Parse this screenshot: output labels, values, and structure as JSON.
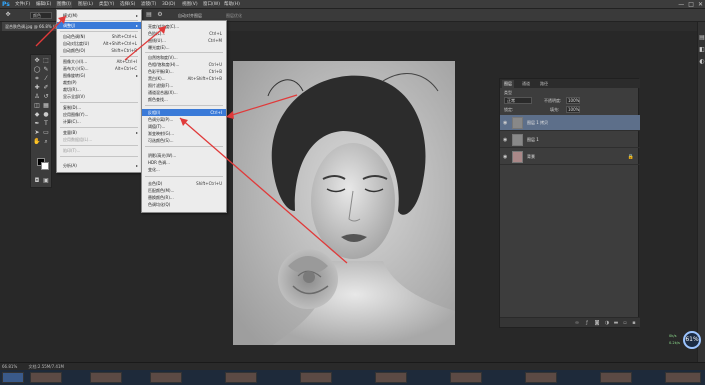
{
  "app": {
    "logo": "Ps",
    "menus": [
      "文件(F)",
      "编辑(E)",
      "图像(I)",
      "图层(L)",
      "类型(Y)",
      "选择(S)",
      "滤镜(T)",
      "3D(D)",
      "视图(V)",
      "窗口(W)",
      "帮助(H)"
    ],
    "window_controls": [
      "—",
      "□",
      "✕"
    ]
  },
  "options_bar": {
    "mode_value": "颜色",
    "auto_align_label": "自动对齐图层",
    "checkbox_label": "图层优化"
  },
  "document": {
    "tab_label": "混合肤色调.jpg @ 66.8% (图层 1 拷贝, RGB/8)"
  },
  "image_menu": {
    "items": [
      {
        "label": "模式(M)",
        "shortcut": "",
        "submenu": true
      },
      {
        "label": "调整(J)",
        "shortcut": "",
        "submenu": true,
        "highlighted": true
      },
      {
        "label": "自动色调(N)",
        "shortcut": "Shift+Ctrl+L"
      },
      {
        "label": "自动对比度(U)",
        "shortcut": "Alt+Shift+Ctrl+L"
      },
      {
        "label": "自动颜色(O)",
        "shortcut": "Shift+Ctrl+B"
      },
      {
        "label": "图像大小(I)...",
        "shortcut": "Alt+Ctrl+I"
      },
      {
        "label": "画布大小(S)...",
        "shortcut": "Alt+Ctrl+C"
      },
      {
        "label": "图像旋转(G)",
        "shortcut": "",
        "submenu": true
      },
      {
        "label": "裁剪(P)",
        "shortcut": ""
      },
      {
        "label": "裁切(R)...",
        "shortcut": ""
      },
      {
        "label": "显示全部(V)",
        "shortcut": ""
      },
      {
        "label": "复制(D)...",
        "shortcut": ""
      },
      {
        "label": "应用图像(Y)...",
        "shortcut": ""
      },
      {
        "label": "计算(C)...",
        "shortcut": ""
      },
      {
        "label": "变量(B)",
        "shortcut": "",
        "submenu": true
      },
      {
        "label": "应用数据组(L)...",
        "shortcut": "",
        "disabled": true
      },
      {
        "label": "陷印(T)...",
        "shortcut": "",
        "disabled": true
      },
      {
        "label": "分析(A)",
        "shortcut": "",
        "submenu": true
      }
    ]
  },
  "adjust_menu": {
    "items": [
      {
        "label": "亮度/对比度(C)...",
        "shortcut": ""
      },
      {
        "label": "色阶(L)...",
        "shortcut": "Ctrl+L"
      },
      {
        "label": "曲线(U)...",
        "shortcut": "Ctrl+M"
      },
      {
        "label": "曝光度(E)...",
        "shortcut": ""
      },
      {
        "label": "自然饱和度(V)...",
        "shortcut": ""
      },
      {
        "label": "色相/饱和度(H)...",
        "shortcut": "Ctrl+U"
      },
      {
        "label": "色彩平衡(B)...",
        "shortcut": "Ctrl+B"
      },
      {
        "label": "黑白(K)...",
        "shortcut": "Alt+Shift+Ctrl+B"
      },
      {
        "label": "照片滤镜(F)...",
        "shortcut": ""
      },
      {
        "label": "通道混合器(X)...",
        "shortcut": ""
      },
      {
        "label": "颜色查找...",
        "shortcut": ""
      },
      {
        "label": "反相(I)",
        "shortcut": "Ctrl+I",
        "highlighted": true
      },
      {
        "label": "色调分离(P)...",
        "shortcut": ""
      },
      {
        "label": "阈值(T)...",
        "shortcut": ""
      },
      {
        "label": "渐变映射(G)...",
        "shortcut": ""
      },
      {
        "label": "可选颜色(S)...",
        "shortcut": ""
      },
      {
        "label": "阴影/高光(W)...",
        "shortcut": ""
      },
      {
        "label": "HDR 色调...",
        "shortcut": ""
      },
      {
        "label": "变化...",
        "shortcut": ""
      },
      {
        "label": "去色(D)",
        "shortcut": "Shift+Ctrl+U"
      },
      {
        "label": "匹配颜色(M)...",
        "shortcut": ""
      },
      {
        "label": "替换颜色(R)...",
        "shortcut": ""
      },
      {
        "label": "色调均化(Q)",
        "shortcut": ""
      }
    ]
  },
  "layers_panel": {
    "tabs": [
      "图层",
      "通道",
      "路径"
    ],
    "blend_mode": "正常",
    "opacity_label": "不透明度:",
    "opacity_value": "100%",
    "lock_label": "锁定:",
    "fill_label": "填充:",
    "fill_value": "100%",
    "kind_label": "类型",
    "layers": [
      {
        "name": "图层 1 拷贝",
        "selected": true,
        "locked": false
      },
      {
        "name": "图层 1",
        "selected": false,
        "locked": false
      },
      {
        "name": "背景",
        "selected": false,
        "locked": true
      }
    ]
  },
  "status": {
    "zoom": "66.81%",
    "doc_size": "文档:2.55M/7.41M"
  },
  "performance": {
    "percent": "61%",
    "upload": "0k/s",
    "download": "0.2k/s"
  },
  "colors": {
    "highlight": "#3a7ad8",
    "arrow": "#e03a3a",
    "selected_layer": "#5d6f8a"
  }
}
